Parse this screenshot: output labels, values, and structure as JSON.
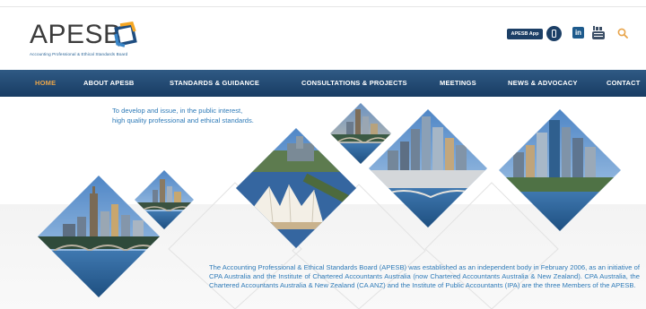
{
  "brand": {
    "name": "APESB",
    "full_name": "Accounting Professional & Ethical Standards Board",
    "mark_colors": [
      "#1e4d80",
      "#f5a623",
      "#3a86c8"
    ]
  },
  "header": {
    "app_button_label": "APESB App",
    "icons": [
      "phone-icon",
      "linkedin-icon",
      "youtube-icon",
      "search-icon"
    ],
    "linkedin_glyph": "in"
  },
  "nav": {
    "items": [
      {
        "label": "HOME",
        "active": true
      },
      {
        "label": "ABOUT APESB",
        "active": false
      },
      {
        "label": "STANDARDS & GUIDANCE",
        "active": false
      },
      {
        "label": "CONSULTATIONS & PROJECTS",
        "active": false
      },
      {
        "label": "MEETINGS",
        "active": false
      },
      {
        "label": "NEWS & ADVOCACY",
        "active": false
      },
      {
        "label": "CONTACT",
        "active": false
      }
    ],
    "active_color": "#e8a44a"
  },
  "hero": {
    "tagline_line1": "To develop and issue, in the public interest,",
    "tagline_line2": "high quality professional and ethical standards.",
    "intro": "The Accounting Professional & Ethical Standards Board (APESB) was established as an independent body in February 2006, as an initiative of CPA Australia and the Institute of Chartered Accountants Australia (now Chartered Accountants Australia & New Zealand). CPA Australia, the Chartered Accountants Australia & New Zealand (CA ANZ) and the Institute of Public Accountants (IPA) are the three Members of the APESB.",
    "text_color": "#2f7bb8"
  }
}
